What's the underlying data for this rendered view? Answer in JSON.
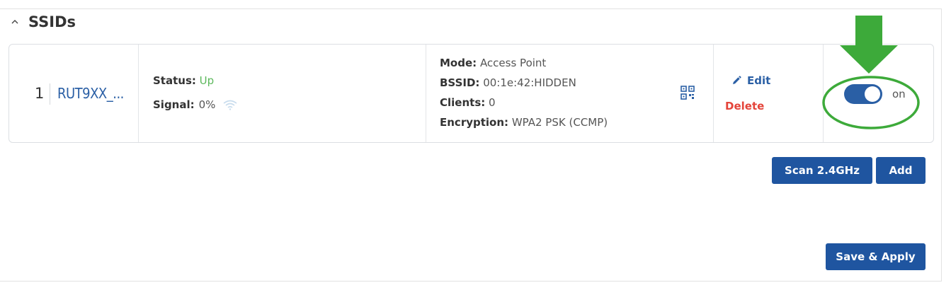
{
  "section": {
    "title": "SSIDs",
    "collapse_icon": "chevron-up-icon"
  },
  "ssid_rows": [
    {
      "index": "1",
      "name": "RUT9XX_...",
      "status_label": "Status:",
      "status_value": "Up",
      "signal_label": "Signal:",
      "signal_value": "0%",
      "signal_icon": "wifi-icon",
      "mode_label": "Mode:",
      "mode_value": "Access Point",
      "bssid_label": "BSSID:",
      "bssid_value": "00:1e:42:HIDDEN",
      "clients_label": "Clients:",
      "clients_value": "0",
      "encryption_label": "Encryption:",
      "encryption_value": "WPA2 PSK (CCMP)",
      "qr_icon": "qr-code-icon",
      "edit_label": "Edit",
      "edit_icon": "pencil-icon",
      "delete_label": "Delete",
      "toggle_state": "on",
      "toggle_label": "on"
    }
  ],
  "buttons": {
    "scan_label": "Scan 2.4GHz",
    "add_label": "Add",
    "save_label": "Save & Apply"
  },
  "annotation": {
    "arrow_icon": "arrow-down-icon",
    "arrow_color": "#3daa3a",
    "highlight_color": "#3daa3a"
  },
  "colors": {
    "accent": "#1f55a0",
    "link": "#2a5fa5",
    "status_up": "#5cb85c",
    "delete": "#e4443a"
  }
}
